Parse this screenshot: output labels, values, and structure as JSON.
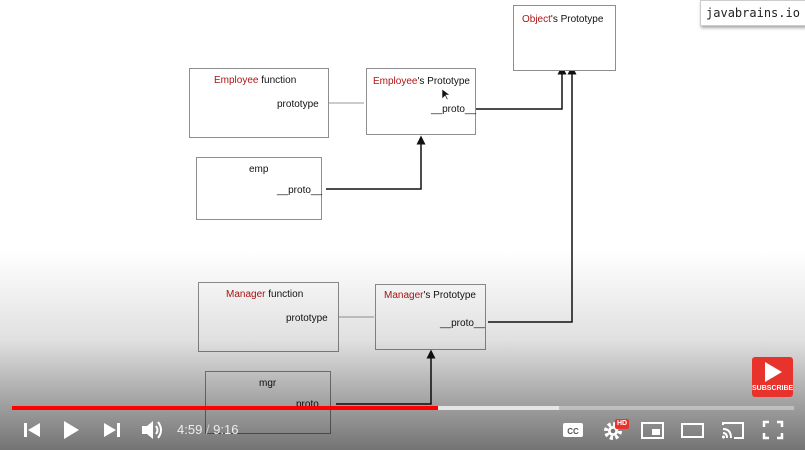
{
  "watermark": "javabrains.io",
  "diagram": {
    "object_prototype": {
      "name": "Object",
      "suffix": "'s Prototype"
    },
    "employee_function": {
      "name": "Employee",
      "suffix": " function",
      "field": "prototype"
    },
    "employee_prototype": {
      "name": "Employee",
      "suffix": "'s Prototype",
      "field": "__proto__"
    },
    "emp": {
      "name": "emp",
      "field": "__proto__"
    },
    "manager_function": {
      "name": "Manager",
      "suffix": " function",
      "field": "prototype"
    },
    "manager_prototype": {
      "name": "Manager",
      "suffix": "'s Prototype",
      "field": "__proto__"
    },
    "mgr": {
      "name": "mgr",
      "field": "proto"
    }
  },
  "subscribe_label": "SUBSCRIBE",
  "player": {
    "current_time": "4:59",
    "separator": " / ",
    "duration": "9:16",
    "played_fraction": 0.5447,
    "buffered_fraction": 0.7,
    "hd_badge": "HD",
    "accent": "#ff0000",
    "icons": [
      "previous-icon",
      "play-icon",
      "next-icon",
      "volume-icon",
      "captions-icon",
      "settings-icon",
      "miniplayer-icon",
      "theater-icon",
      "cast-icon",
      "fullscreen-icon"
    ]
  }
}
